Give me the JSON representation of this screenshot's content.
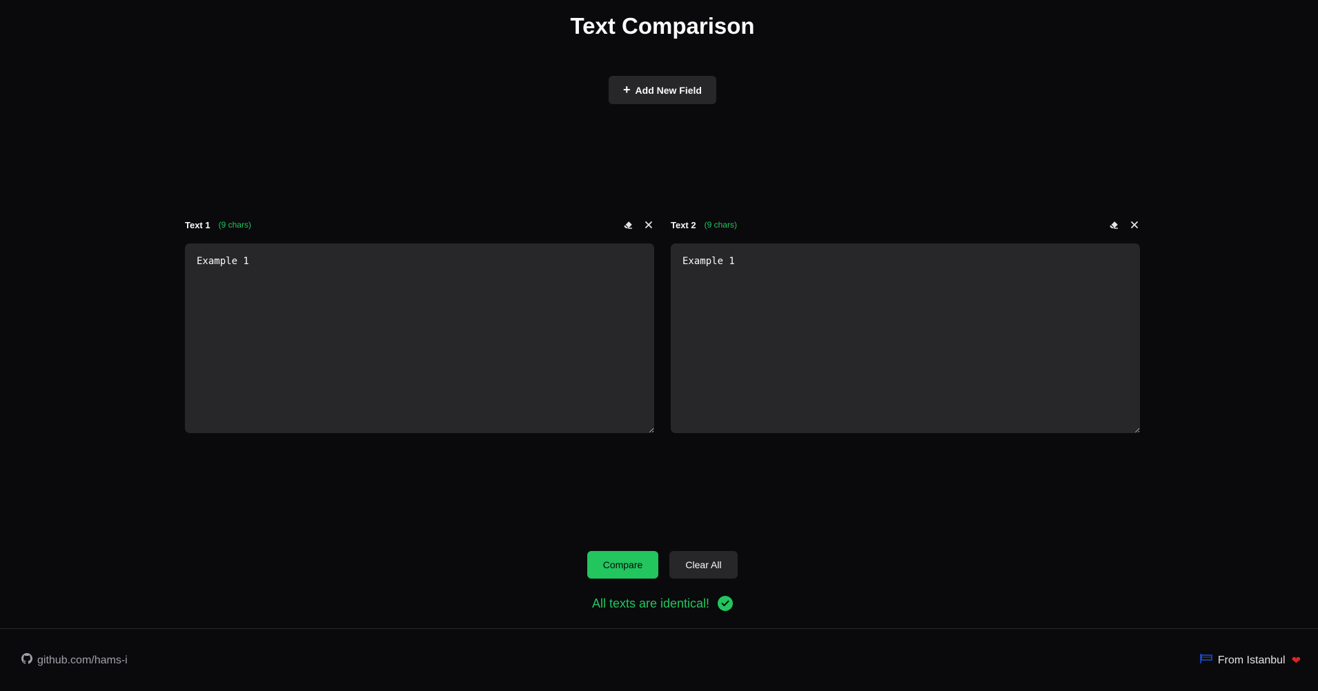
{
  "header": {
    "title": "Text Comparison"
  },
  "toolbar": {
    "add_field_label": "Add New Field",
    "add_icon": "plus-icon"
  },
  "fields": [
    {
      "label": "Text 1",
      "char_count": "(9 chars)",
      "value": "Example 1"
    },
    {
      "label": "Text 2",
      "char_count": "(9 chars)",
      "value": "Example 1"
    }
  ],
  "actions": {
    "compare_label": "Compare",
    "clear_label": "Clear All"
  },
  "result": {
    "message": "All texts are identical!"
  },
  "footer": {
    "github_link": "github.com/hams-i",
    "location": "From Istanbul",
    "heart": "❤"
  },
  "colors": {
    "background": "#0a0a0c",
    "surface": "#27272a",
    "accent": "#22c55e",
    "heart": "#dc2626"
  }
}
